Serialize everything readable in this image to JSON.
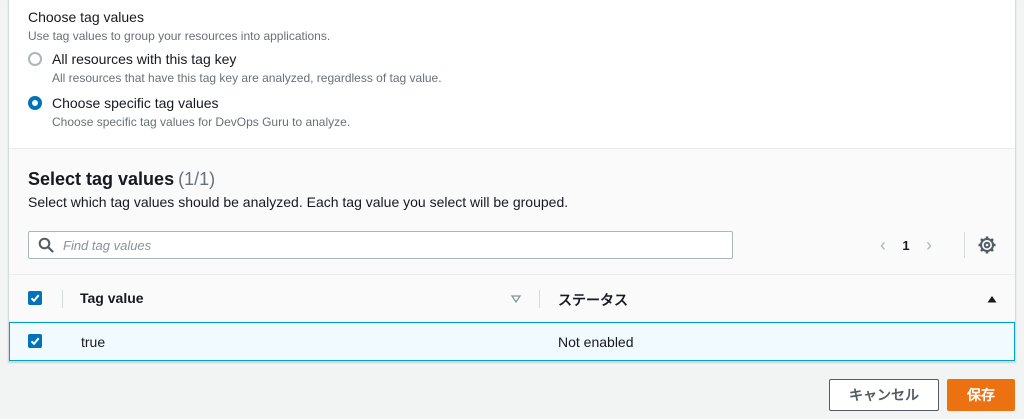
{
  "tag_values_section": {
    "label": "Choose tag values",
    "description": "Use tag values to group your resources into applications.",
    "options": [
      {
        "label": "All resources with this tag key",
        "description": "All resources that have this tag key are analyzed, regardless of tag value.",
        "checked": false
      },
      {
        "label": "Choose specific tag values",
        "description": "Choose specific tag values for DevOps Guru to analyze.",
        "checked": true
      }
    ]
  },
  "table": {
    "title": "Select tag values",
    "count": "(1/1)",
    "description": "Select which tag values should be analyzed. Each tag value you select will be grouped.",
    "search_placeholder": "Find tag values",
    "pagination": {
      "current_page": "1"
    },
    "columns": [
      "Tag value",
      "ステータス"
    ],
    "rows": [
      {
        "tag_value": "true",
        "status": "Not enabled",
        "selected": true
      }
    ]
  },
  "footer": {
    "cancel_label": "キャンセル",
    "save_label": "保存"
  },
  "colors": {
    "accent": "#0073bb",
    "primary_button": "#ec7211",
    "selected_row_bg": "#f1faff",
    "selected_row_border": "#00a1c9"
  }
}
